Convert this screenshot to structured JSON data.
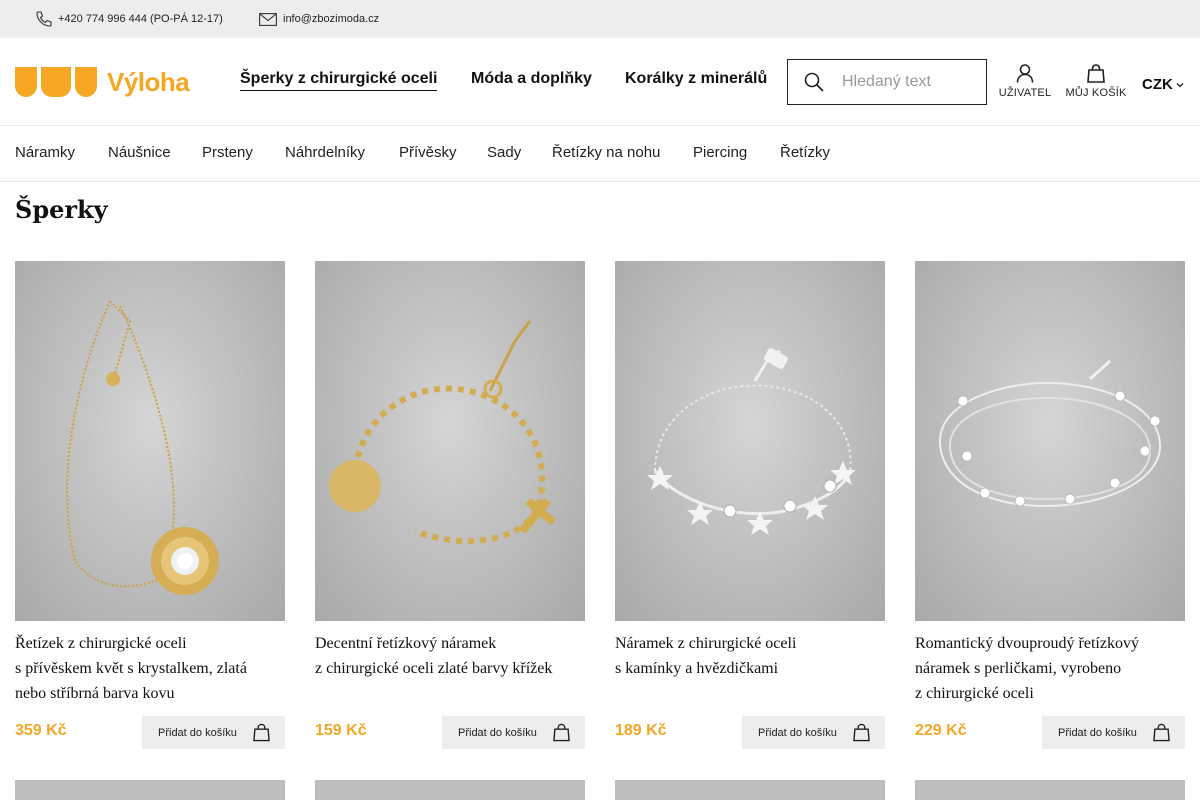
{
  "topbar": {
    "phone": "+420 774 996 444 (PO-PÁ 12-17)",
    "email": "info@zbozimoda.cz"
  },
  "header": {
    "logo_text": "Výloha",
    "nav": [
      "Šperky z chirurgické oceli",
      "Móda a doplňky",
      "Korálky z minerálů"
    ],
    "search_placeholder": "Hledaný text",
    "user_label": "UŽIVATEL",
    "cart_label": "MŮJ KOŠÍK",
    "currency": "CZK"
  },
  "categories": [
    "Náramky",
    "Náušnice",
    "Prsteny",
    "Náhrdelníky",
    "Přívěsky",
    "Sady",
    "Řetízky na nohu",
    "Piercing",
    "Řetízky"
  ],
  "page_title": "Šperky",
  "products": [
    {
      "name_line1": "Řetízek z chirurgické oceli",
      "name_line2": "s přívěskem květ s krystalkem, zlatá",
      "name_line3": "nebo stříbrná barva kovu",
      "price": "359 Kč",
      "button": "Přidat do košíku",
      "image": "gold-necklace-flower-pendant"
    },
    {
      "name_line1": "Decentní řetízkový náramek",
      "name_line2": "z chirurgické oceli zlaté barvy křížek",
      "name_line3": "",
      "price": "159 Kč",
      "button": "Přidat do košíku",
      "image": "gold-bracelet-cross"
    },
    {
      "name_line1": "Náramek z chirurgické oceli",
      "name_line2": "s kamínky a hvězdičkami",
      "name_line3": "",
      "price": "189 Kč",
      "button": "Přidat do košíku",
      "image": "silver-bracelet-stars"
    },
    {
      "name_line1": "Romantický dvouproudý řetízkový",
      "name_line2": "náramek s perličkami, vyrobeno",
      "name_line3": "z chirurgické oceli",
      "price": "229 Kč",
      "button": "Přidat do košíku",
      "image": "silver-bracelet-pearls"
    }
  ],
  "colors": {
    "accent": "#f5a623",
    "topbar": "#ededed",
    "button": "#ededed"
  }
}
